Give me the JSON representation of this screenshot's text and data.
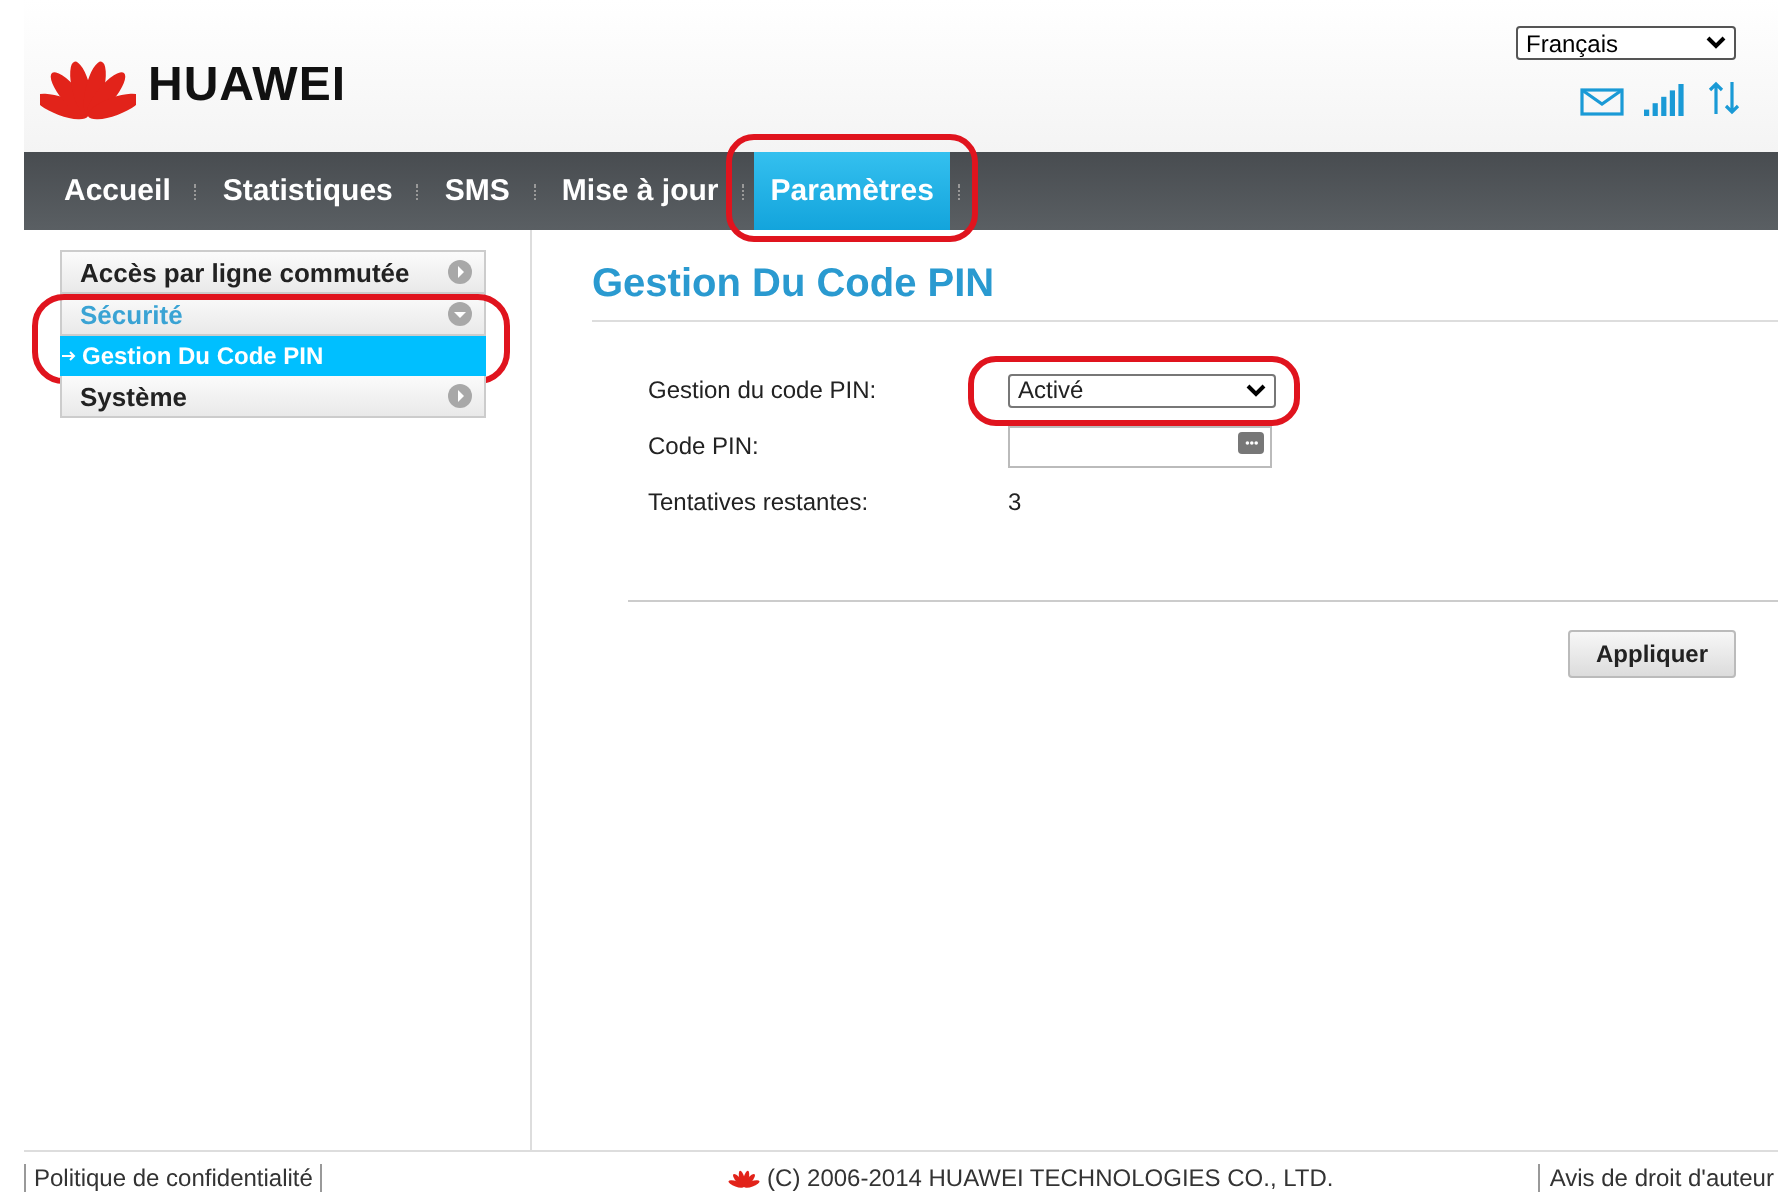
{
  "brand": "HUAWEI",
  "language": {
    "value": "Français"
  },
  "nav": [
    {
      "label": "Accueil",
      "selected": false,
      "highlighted": false
    },
    {
      "label": "Statistiques",
      "selected": false,
      "highlighted": false
    },
    {
      "label": "SMS",
      "selected": false,
      "highlighted": false
    },
    {
      "label": "Mise à jour",
      "selected": false,
      "highlighted": false
    },
    {
      "label": "Paramètres",
      "selected": true,
      "highlighted": true
    }
  ],
  "sidebar": [
    {
      "label": "Accès par ligne commutée",
      "expanded": false,
      "highlighted": false
    },
    {
      "label": "Sécurité",
      "expanded": true,
      "highlighted": true,
      "children": [
        {
          "label": "Gestion Du Code PIN",
          "selected": true
        }
      ]
    },
    {
      "label": "Système",
      "expanded": false,
      "highlighted": false
    }
  ],
  "page_title": "Gestion Du Code PIN",
  "form": [
    {
      "kind": "select",
      "label": "Gestion du code PIN:",
      "value": "Activé",
      "highlighted": true
    },
    {
      "kind": "password",
      "label": "Code PIN:",
      "highlighted": false
    },
    {
      "kind": "text",
      "label": "Tentatives restantes:",
      "value": "3",
      "highlighted": false
    }
  ],
  "apply_button": "Appliquer",
  "footer": {
    "left": "Politique de confidentialité",
    "center": "(C) 2006-2014 HUAWEI TECHNOLOGIES CO., LTD.",
    "right": "Avis de droit d'auteur"
  }
}
